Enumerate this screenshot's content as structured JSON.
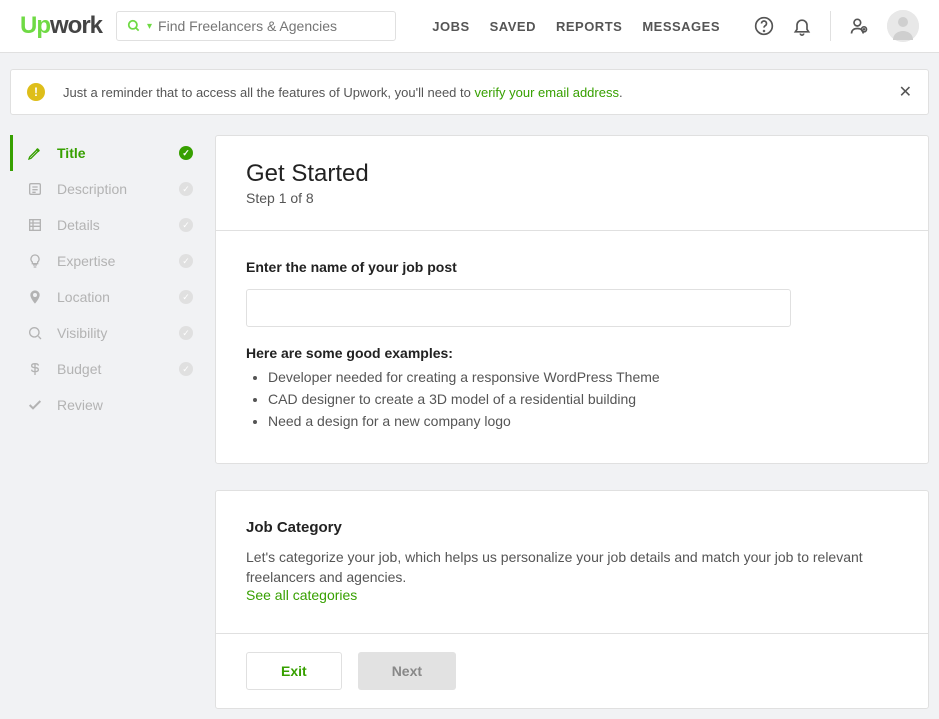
{
  "header": {
    "logo_up": "Up",
    "logo_work": "work",
    "search_placeholder": "Find Freelancers & Agencies",
    "nav": {
      "jobs": "JOBS",
      "saved": "SAVED",
      "reports": "REPORTS",
      "messages": "MESSAGES"
    }
  },
  "banner": {
    "text_before": "Just a reminder that to access all the features of Upwork, you'll need to ",
    "link": "verify your email address",
    "text_after": "."
  },
  "sidebar": {
    "items": [
      {
        "label": "Title"
      },
      {
        "label": "Description"
      },
      {
        "label": "Details"
      },
      {
        "label": "Expertise"
      },
      {
        "label": "Location"
      },
      {
        "label": "Visibility"
      },
      {
        "label": "Budget"
      },
      {
        "label": "Review"
      }
    ]
  },
  "main": {
    "heading": "Get Started",
    "subheading": "Step 1 of 8",
    "title_prompt": "Enter the name of your job post",
    "examples_heading": "Here are some good examples:",
    "examples": [
      "Developer needed for creating a responsive WordPress Theme",
      "CAD designer to create a 3D model of a residential building",
      "Need a design for a new company logo"
    ],
    "category": {
      "title": "Job Category",
      "desc": "Let's categorize your job, which helps us personalize your job details and match your job to relevant freelancers and agencies.",
      "link": "See all categories"
    },
    "buttons": {
      "exit": "Exit",
      "next": "Next"
    }
  }
}
